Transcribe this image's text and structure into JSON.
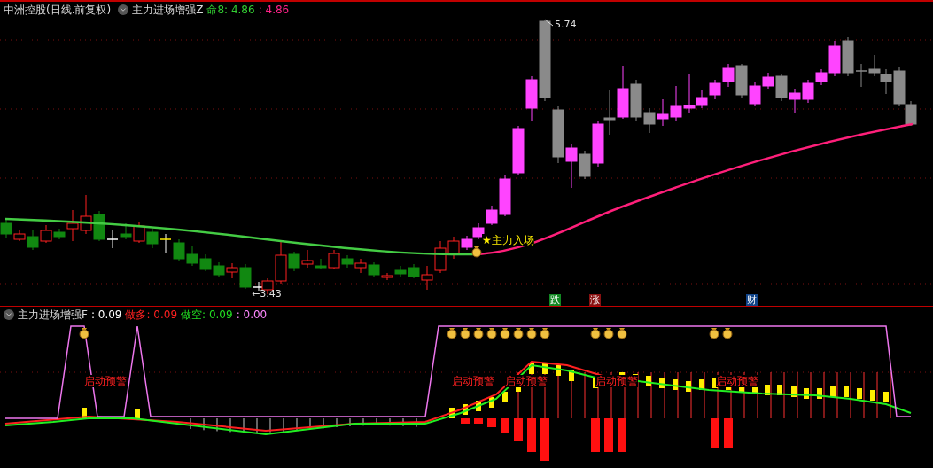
{
  "header": {
    "title": "中洲控股(日线.前复权)",
    "indicator": "主力进场增强Z",
    "values": [
      {
        "text": "命8: 4.86",
        "color": "#33cc33"
      },
      {
        "text": ": 4.86",
        "color": "#ff2288"
      }
    ]
  },
  "main_chart": {
    "annotations": [
      {
        "text": "5.74"
      },
      {
        "text": "←3.43"
      }
    ],
    "signal": "★主力入场",
    "markers": [
      {
        "text": "跌",
        "color": "#118822"
      },
      {
        "text": "涨",
        "color": "#881111"
      },
      {
        "text": "财",
        "color": "#114488"
      }
    ]
  },
  "sub_header": {
    "indicator": "主力进场增强F",
    "values": [
      {
        "text": ": 0.09",
        "color": "#ffffff"
      },
      {
        "text": "做多: 0.09",
        "color": "#ff2020"
      },
      {
        "text": "做空: 0.09",
        "color": "#22dd22"
      },
      {
        "text": ": 0.00",
        "color": "#ff88ff"
      }
    ]
  },
  "sub_chart": {
    "warnings": [
      {
        "text": "启动预警"
      },
      {
        "text": "启动预警"
      },
      {
        "text": "启动预警"
      },
      {
        "text": "启动预警"
      },
      {
        "text": "启动预警"
      }
    ]
  }
}
